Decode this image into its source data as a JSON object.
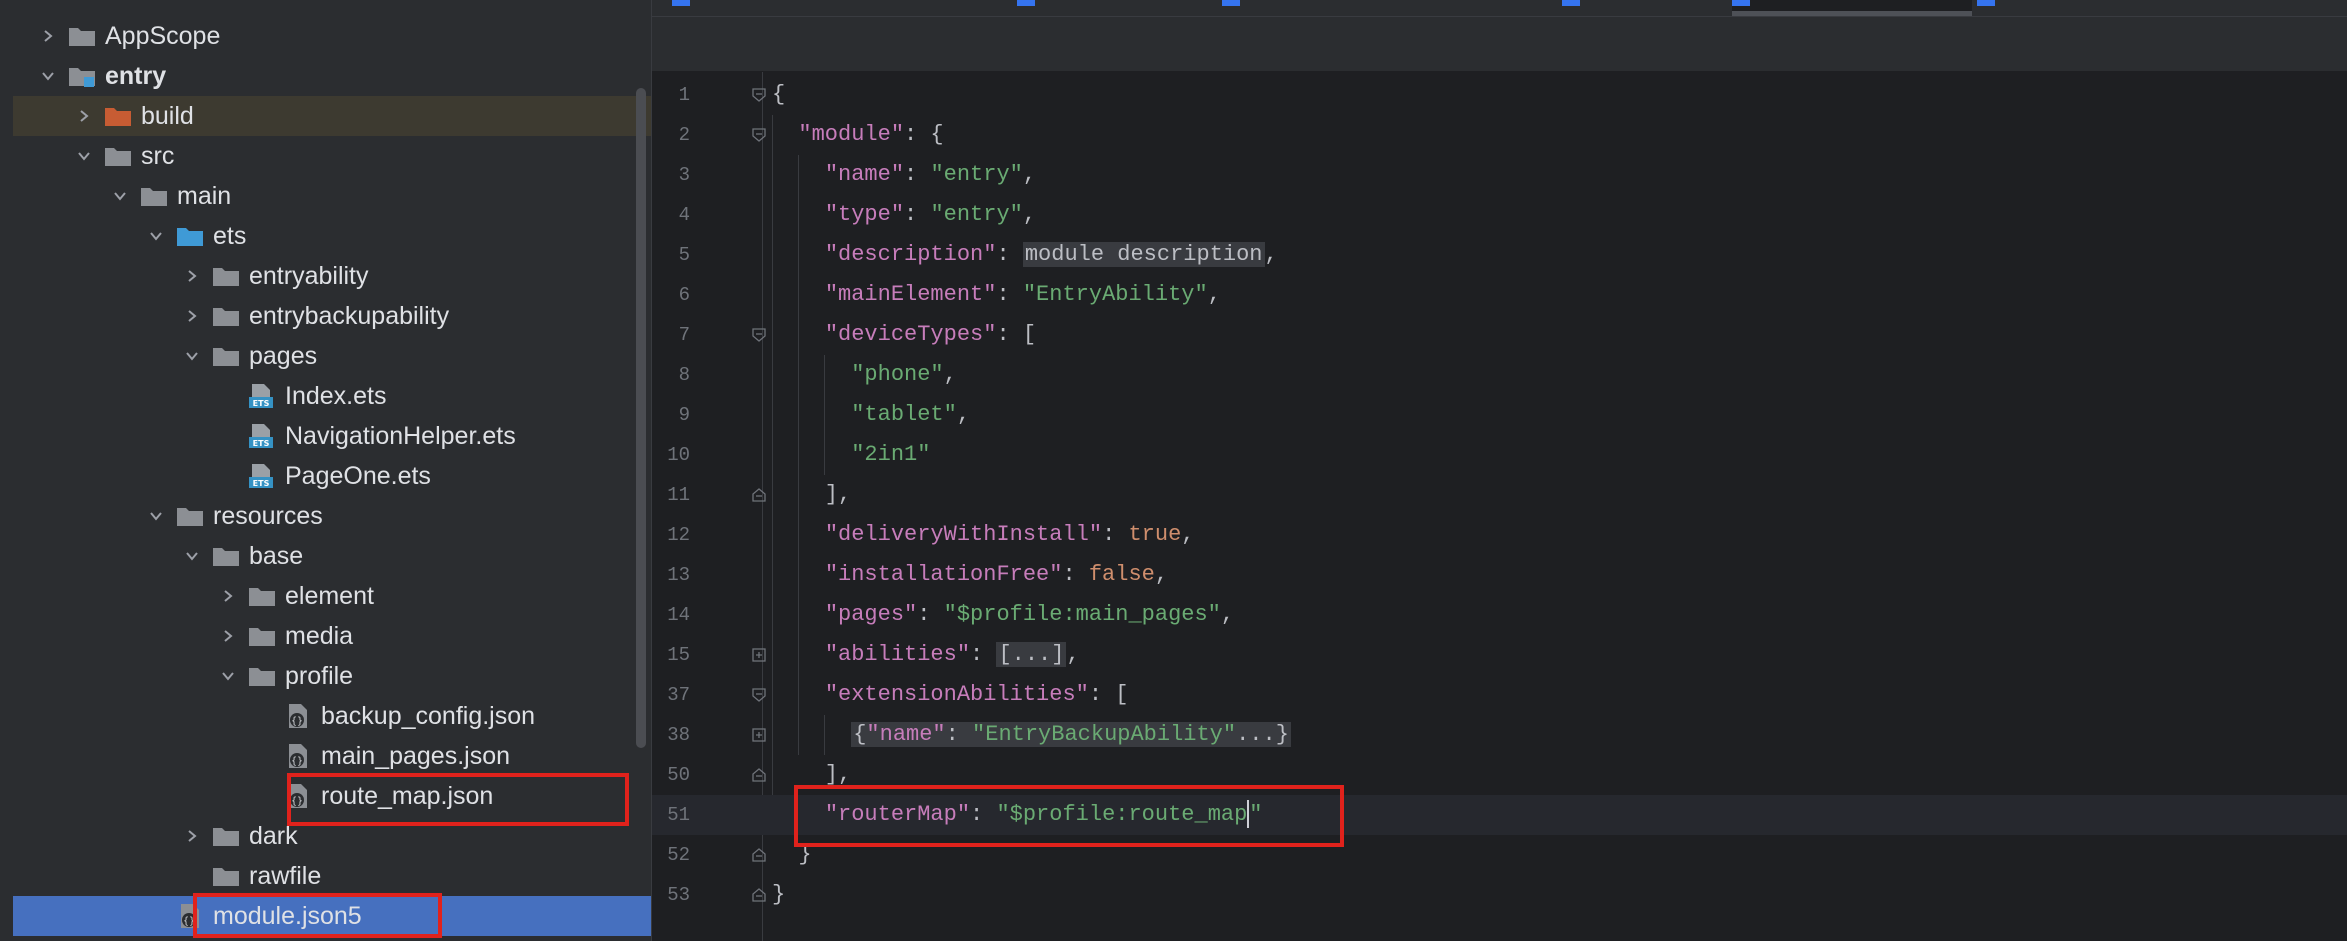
{
  "colors": {
    "annotation": "#e0221c",
    "selection": "#4670bf",
    "string": "#6aab73",
    "key": "#c77dbb",
    "keyword": "#cf8e6d",
    "folder": "#8c8f94",
    "build_folder": "#c75c33",
    "source_folder": "#3f9ad6"
  },
  "tabs": [
    {
      "label": "",
      "icon": "file-icon"
    },
    {
      "label": "",
      "icon": "file-icon"
    },
    {
      "label": "",
      "icon": "file-icon"
    },
    {
      "label": "",
      "icon": "json-icon"
    },
    {
      "label": "",
      "icon": "json-icon",
      "active": true
    },
    {
      "label": "",
      "icon": "json-icon"
    }
  ],
  "tree": [
    {
      "label": "AppScope",
      "expanded": false,
      "icon": "folder-icon"
    },
    {
      "label": "entry",
      "expanded": true,
      "icon": "module-folder-icon",
      "bold": true
    },
    {
      "label": "build",
      "expanded": false,
      "icon": "excluded-folder-icon"
    },
    {
      "label": "src",
      "expanded": true,
      "icon": "folder-icon"
    },
    {
      "label": "main",
      "expanded": true,
      "icon": "folder-icon"
    },
    {
      "label": "ets",
      "expanded": true,
      "icon": "source-folder-icon"
    },
    {
      "label": "entryability",
      "expanded": false,
      "icon": "folder-icon"
    },
    {
      "label": "entrybackupability",
      "expanded": false,
      "icon": "folder-icon"
    },
    {
      "label": "pages",
      "expanded": true,
      "icon": "folder-icon"
    },
    {
      "label": "Index.ets",
      "icon": "ets-file-icon"
    },
    {
      "label": "NavigationHelper.ets",
      "icon": "ets-file-icon"
    },
    {
      "label": "PageOne.ets",
      "icon": "ets-file-icon"
    },
    {
      "label": "resources",
      "expanded": true,
      "icon": "folder-icon"
    },
    {
      "label": "base",
      "expanded": true,
      "icon": "folder-icon"
    },
    {
      "label": "element",
      "expanded": false,
      "icon": "folder-icon"
    },
    {
      "label": "media",
      "expanded": false,
      "icon": "folder-icon"
    },
    {
      "label": "profile",
      "expanded": true,
      "icon": "folder-icon"
    },
    {
      "label": "backup_config.json",
      "icon": "json-file-icon"
    },
    {
      "label": "main_pages.json",
      "icon": "json-file-icon"
    },
    {
      "label": "route_map.json",
      "icon": "json-file-icon"
    },
    {
      "label": "dark",
      "expanded": false,
      "icon": "folder-icon"
    },
    {
      "label": "rawfile",
      "icon": "folder-icon"
    },
    {
      "label": "module.json5",
      "icon": "json-file-icon",
      "selected": true
    }
  ],
  "code_lines": [
    {
      "num": "1",
      "text": "{"
    },
    {
      "num": "2",
      "text": "  \"module\": {"
    },
    {
      "num": "3",
      "text": "    \"name\": \"entry\","
    },
    {
      "num": "4",
      "text": "    \"type\": \"entry\","
    },
    {
      "num": "5",
      "text": "    \"description\": module description,"
    },
    {
      "num": "6",
      "text": "    \"mainElement\": \"EntryAbility\","
    },
    {
      "num": "7",
      "text": "    \"deviceTypes\": ["
    },
    {
      "num": "8",
      "text": "      \"phone\","
    },
    {
      "num": "9",
      "text": "      \"tablet\","
    },
    {
      "num": "10",
      "text": "      \"2in1\""
    },
    {
      "num": "11",
      "text": "    ],"
    },
    {
      "num": "12",
      "text": "    \"deliveryWithInstall\": true,"
    },
    {
      "num": "13",
      "text": "    \"installationFree\": false,"
    },
    {
      "num": "14",
      "text": "    \"pages\": \"$profile:main_pages\","
    },
    {
      "num": "15",
      "text": "    \"abilities\": [...],"
    },
    {
      "num": "37",
      "text": "    \"extensionAbilities\": ["
    },
    {
      "num": "38",
      "text": "      {\"name\": \"EntryBackupAbility\"...}"
    },
    {
      "num": "50",
      "text": "    ],"
    },
    {
      "num": "51",
      "text": "    \"routerMap\": \"$profile:route_map\""
    },
    {
      "num": "52",
      "text": "  }"
    },
    {
      "num": "53",
      "text": "}"
    }
  ]
}
